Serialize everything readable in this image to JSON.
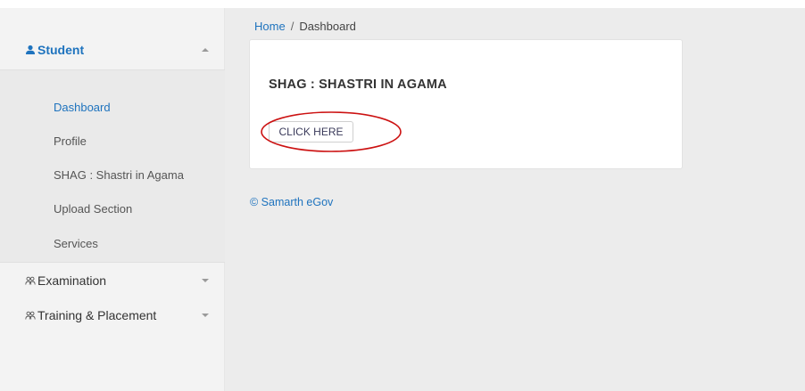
{
  "sidebar": {
    "student": {
      "label": "Student",
      "items": [
        {
          "label": "Dashboard"
        },
        {
          "label": "Profile"
        },
        {
          "label": "SHAG : Shastri in Agama"
        },
        {
          "label": "Upload Section"
        },
        {
          "label": "Services"
        }
      ]
    },
    "examination": {
      "label": "Examination"
    },
    "training": {
      "label": "Training & Placement"
    }
  },
  "breadcrumb": {
    "home": "Home",
    "separator": "/",
    "current": "Dashboard"
  },
  "card": {
    "title": "SHAG : SHASTRI IN AGAMA",
    "button_label": "CLICK HERE"
  },
  "footer": {
    "text": "© Samarth eGov"
  },
  "colors": {
    "accent": "#1e73be",
    "annotation": "#cc1111"
  },
  "icons": {
    "student": "user-icon",
    "examination": "users-icon",
    "training": "users-icon"
  }
}
